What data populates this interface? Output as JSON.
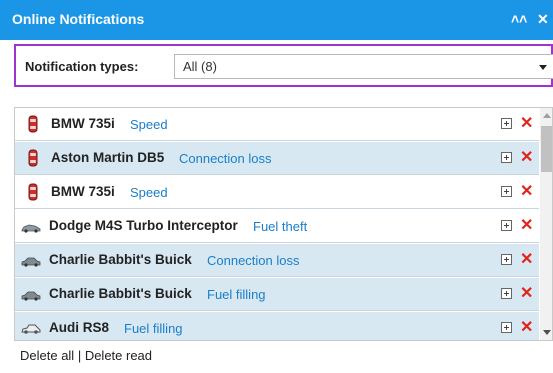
{
  "window": {
    "title": "Online Notifications",
    "collapse_icon": "double-chevron-up-icon",
    "close_icon": "close-icon",
    "accent_color": "#1b96e6"
  },
  "filter": {
    "label": "Notification types:",
    "selected": "All (8)",
    "highlight_color": "#9b34d2"
  },
  "notifications": [
    {
      "vehicle": "BMW 735i",
      "event": "Speed",
      "icon": "car-icon-red-topdown",
      "alt": false
    },
    {
      "vehicle": "Aston Martin DB5",
      "event": "Connection loss",
      "icon": "car-icon-red-topdown",
      "alt": true
    },
    {
      "vehicle": "BMW 735i",
      "event": "Speed",
      "icon": "car-icon-red-topdown",
      "alt": false
    },
    {
      "vehicle": "Dodge M4S Turbo Interceptor",
      "event": "Fuel theft",
      "icon": "sports-car-icon",
      "alt": false
    },
    {
      "vehicle": "Charlie Babbit's Buick",
      "event": "Connection loss",
      "icon": "sedan-icon",
      "alt": true
    },
    {
      "vehicle": "Charlie Babbit's Buick",
      "event": "Fuel filling",
      "icon": "sedan-icon",
      "alt": true
    },
    {
      "vehicle": "Audi RS8",
      "event": "Fuel filling",
      "icon": "coupe-icon",
      "alt": true
    }
  ],
  "row_actions": {
    "expand_icon": "expand-plus-icon",
    "delete_icon": "delete-x-icon",
    "delete_color": "#e0231b"
  },
  "footer": {
    "delete_all": "Delete all",
    "separator": " | ",
    "delete_read": "Delete read"
  }
}
